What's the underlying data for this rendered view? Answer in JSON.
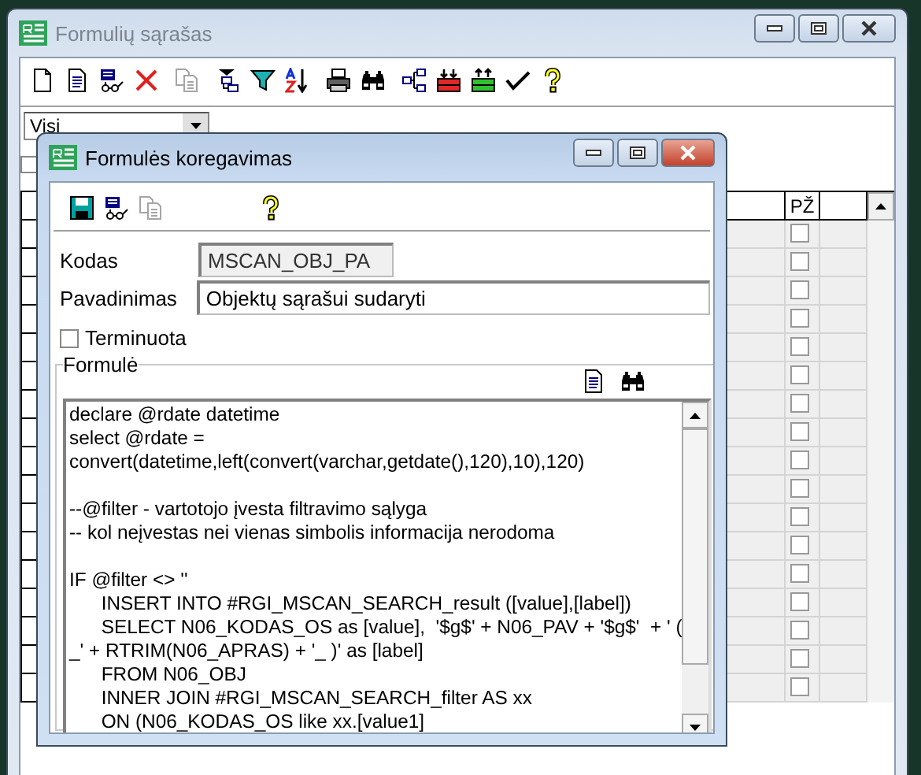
{
  "back_window": {
    "title": "Formulių sąrašas",
    "active": false,
    "toolbar": [
      [
        {
          "kind": "new",
          "disabled": false
        },
        {
          "kind": "edit",
          "disabled": false
        },
        {
          "kind": "view",
          "disabled": false
        },
        {
          "kind": "delete",
          "disabled": false
        }
      ],
      [
        {
          "kind": "copy",
          "disabled": true
        }
      ],
      [
        {
          "kind": "insert",
          "disabled": false
        },
        {
          "kind": "filter",
          "disabled": false
        },
        {
          "kind": "sort",
          "disabled": false
        }
      ],
      [
        {
          "kind": "print",
          "disabled": false
        },
        {
          "kind": "find",
          "disabled": false
        }
      ],
      [
        {
          "kind": "tree",
          "disabled": false
        },
        {
          "kind": "import",
          "disabled": false
        },
        {
          "kind": "export",
          "disabled": false
        },
        {
          "kind": "confirm",
          "disabled": false
        },
        {
          "kind": "help",
          "disabled": false
        }
      ]
    ],
    "filter_dropdown": {
      "value": "Visi"
    },
    "checkbox": {
      "checked": false
    },
    "grid": {
      "pz_column": {
        "label": "PŽ"
      },
      "rows": [
        {
          "checked": false
        },
        {
          "checked": false
        },
        {
          "checked": false
        },
        {
          "checked": false
        },
        {
          "checked": false
        },
        {
          "checked": false
        },
        {
          "checked": false
        },
        {
          "checked": false
        },
        {
          "checked": false
        },
        {
          "checked": false
        },
        {
          "checked": false
        },
        {
          "checked": false
        },
        {
          "checked": false
        },
        {
          "checked": false
        },
        {
          "checked": false
        },
        {
          "checked": false
        },
        {
          "checked": false
        }
      ]
    }
  },
  "front_window": {
    "title": "Formulės koregavimas",
    "active": true,
    "toolbar": [
      [
        {
          "kind": "save",
          "disabled": false
        },
        {
          "kind": "view",
          "disabled": false
        },
        {
          "kind": "copy",
          "disabled": true
        }
      ],
      [
        {
          "kind": "help",
          "disabled": false
        }
      ]
    ],
    "kodas": {
      "label": "Kodas",
      "value": "MSCAN_OBJ_PA",
      "disabled": true
    },
    "pavadinimas": {
      "label": "Pavadinimas",
      "value": "Objektų sąrašui sudaryti"
    },
    "terminuota": {
      "label": "Terminuota",
      "checked": false
    },
    "formula": {
      "legend": "Formulė",
      "tools": [
        {
          "kind": "edit",
          "disabled": false
        },
        {
          "kind": "find",
          "disabled": false
        }
      ],
      "blocks": [
        [
          "declare @rdate datetime",
          "select @rdate =",
          "convert(datetime,left(convert(varchar,getdate(),120),10),120)"
        ],
        [
          "--@filter - vartotojo įvesta filtravimo sąlyga",
          "-- kol neįvestas nei vienas simbolis informacija nerodoma"
        ],
        [
          "IF @filter <> ''",
          "      INSERT INTO #RGI_MSCAN_SEARCH_result ([value],[label])",
          "      SELECT N06_KODAS_OS as [value],  '$g$' + N06_PAV + '$g$'  + ' (",
          "_' + RTRIM(N06_APRAS) + '_ )' as [label]",
          "      FROM N06_OBJ",
          "      INNER JOIN #RGI_MSCAN_SEARCH_filter AS xx",
          "      ON (N06_KODAS_OS like xx.[value1]"
        ]
      ]
    }
  }
}
